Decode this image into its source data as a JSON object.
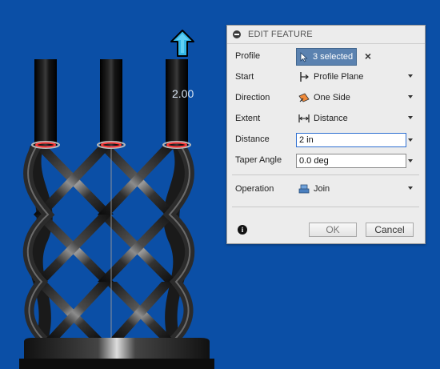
{
  "viewport": {
    "background": "#0b4fa6",
    "dimension_value": "2.00"
  },
  "dialog": {
    "title": "EDIT FEATURE",
    "rows": {
      "profile": {
        "label": "Profile",
        "value": "3 selected"
      },
      "start": {
        "label": "Start",
        "value": "Profile Plane",
        "icon": "profile-plane-icon"
      },
      "direction": {
        "label": "Direction",
        "value": "One Side",
        "icon": "one-side-icon"
      },
      "extent": {
        "label": "Extent",
        "value": "Distance",
        "icon": "distance-icon"
      },
      "distance": {
        "label": "Distance",
        "value": "2 in"
      },
      "taper": {
        "label": "Taper Angle",
        "value": "0.0 deg"
      },
      "operation": {
        "label": "Operation",
        "value": "Join",
        "icon": "join-icon"
      }
    },
    "buttons": {
      "ok": "OK",
      "cancel": "Cancel"
    },
    "accent": "#5b82b0"
  }
}
